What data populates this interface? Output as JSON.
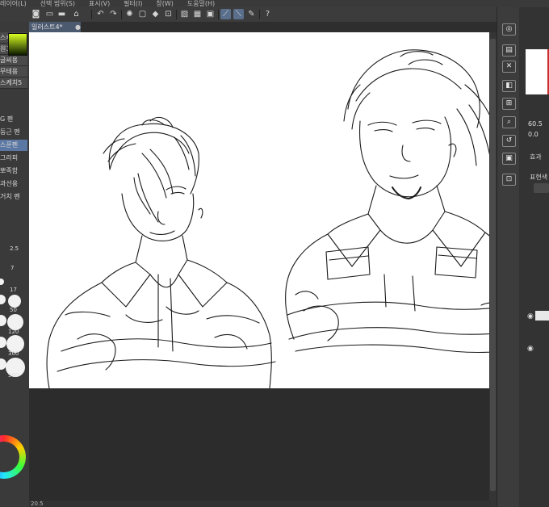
{
  "menubar": [
    "레이어(L)",
    "선택 범위(S)",
    "표시(V)",
    "필터(I)",
    "창(W)",
    "도움말(H)"
  ],
  "document_tab": {
    "title": "일러스트4*"
  },
  "left_panel": {
    "subtool_items": [
      "스케치2",
      "원고용",
      "글씨용",
      "무테용",
      "스케치5"
    ],
    "brush_items": [
      "G 펜",
      "둥근 펜",
      "스푼펜",
      "그라피",
      "뽀족함",
      "과선용",
      "거치 펜"
    ],
    "brush_sizes": [
      "2.5",
      "7",
      "17",
      "50",
      "120",
      "300",
      "500"
    ]
  },
  "right_panel": {
    "values": [
      "60.5",
      "0.0"
    ],
    "labels": [
      "효과",
      "표현색"
    ]
  },
  "statusbar": {
    "zoom": "20.5"
  },
  "colors": {
    "accent": "#5b77a3",
    "panel": "#3a3a3a",
    "canvas_bg": "#2c2c2c"
  }
}
